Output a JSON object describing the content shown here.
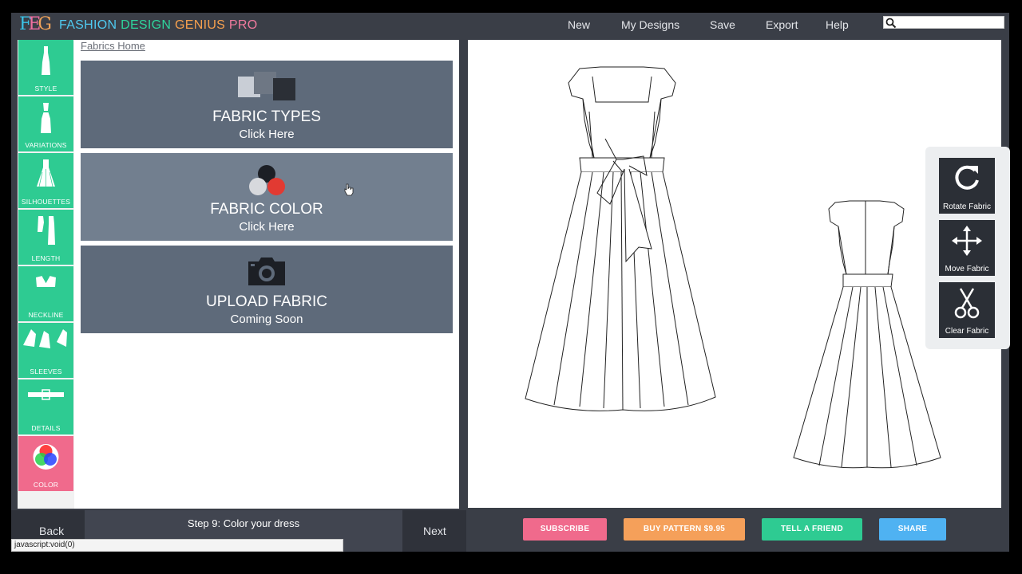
{
  "header": {
    "brand_words": [
      "FASHION",
      "DESIGN",
      "GENIUS",
      "PRO"
    ],
    "logo_letters": [
      "F",
      "E",
      "G"
    ],
    "nav": [
      "New",
      "My Designs",
      "Save",
      "Export",
      "Help"
    ],
    "search_value": ""
  },
  "sidebar": {
    "items": [
      {
        "label": "STYLE",
        "icon": "dress-style-icon"
      },
      {
        "label": "VARIATIONS",
        "icon": "dress-variation-icon"
      },
      {
        "label": "SILHOUETTES",
        "icon": "silhouette-icon"
      },
      {
        "label": "LENGTH",
        "icon": "length-icon"
      },
      {
        "label": "NECKLINE",
        "icon": "neckline-icon"
      },
      {
        "label": "SLEEVES",
        "icon": "sleeves-icon"
      },
      {
        "label": "DETAILS",
        "icon": "belt-icon"
      },
      {
        "label": "COLOR",
        "icon": "color-wheel-icon"
      }
    ],
    "active": "COLOR",
    "colors": {
      "green": "#2ecb92",
      "pink": "#f06a8c"
    }
  },
  "fabrics": {
    "breadcrumb": "Fabrics Home",
    "cards": [
      {
        "title": "FABRIC TYPES",
        "subtitle": "Click Here",
        "icon": "fabric-swatch-icon"
      },
      {
        "title": "FABRIC COLOR",
        "subtitle": "Click Here",
        "icon": "color-dots-icon"
      },
      {
        "title": "UPLOAD FABRIC",
        "subtitle": "Coming Soon",
        "icon": "camera-icon"
      }
    ]
  },
  "footer": {
    "back": "Back",
    "step": "Step 9: Color your dress",
    "next": "Next",
    "status": "javascript:void(0)"
  },
  "tools": [
    {
      "label": "Rotate Fabric",
      "icon": "rotate-icon"
    },
    {
      "label": "Move Fabric",
      "icon": "move-icon"
    },
    {
      "label": "Clear Fabric",
      "icon": "scissors-icon"
    }
  ],
  "actions": [
    {
      "label": "SUBSCRIBE",
      "color": "#f06a8c"
    },
    {
      "label": "BUY PATTERN $9.95",
      "color": "#f5a05a"
    },
    {
      "label": "TELL A FRIEND",
      "color": "#2ecb92"
    },
    {
      "label": "SHARE",
      "color": "#4fb2f2"
    }
  ]
}
